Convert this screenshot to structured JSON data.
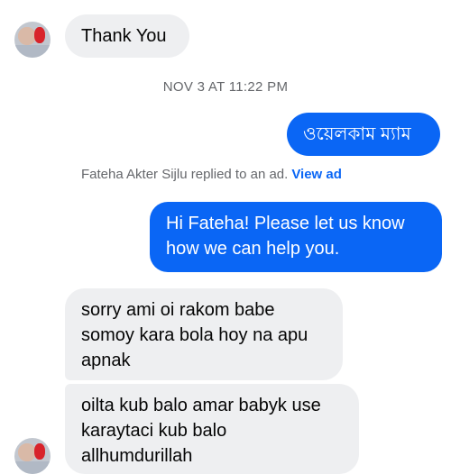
{
  "messages": {
    "m1": "Thank You",
    "timestamp": "NOV 3 AT 11:22 PM",
    "m2": "ওয়েলকাম ম্যাম",
    "reply_note": "Fateha Akter Sijlu replied to an ad.",
    "view_ad": "View ad",
    "m3": "Hi Fateha! Please let us know how we can help you.",
    "m4": "sorry ami oi rakom babe somoy kara bola hoy na apu apnak",
    "m5": "oilta kub balo amar babyk use karaytaci kub balo allhumdurillah"
  },
  "colors": {
    "outgoing_bubble": "#0a66f5",
    "incoming_bubble": "#eeeff1",
    "meta_text": "#65676b"
  }
}
